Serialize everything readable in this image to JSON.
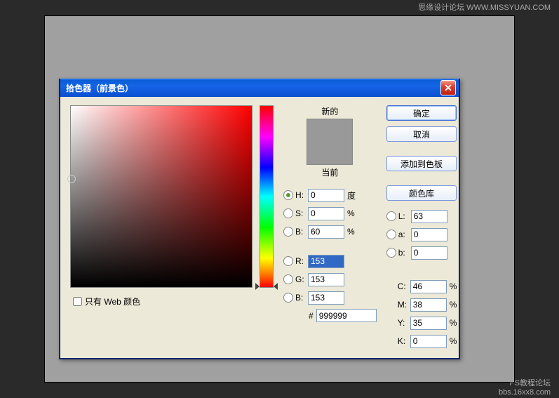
{
  "watermark": {
    "top": "思缘设计论坛  WWW.MISSYUAN.COM",
    "bottom_line1": "PS教程论坛",
    "bottom_line2": "bbs.16xx8.com"
  },
  "dialog": {
    "title": "拾色器（前景色）",
    "swatch": {
      "new_label": "新的",
      "current_label": "当前"
    },
    "buttons": {
      "ok": "确定",
      "cancel": "取消",
      "add": "添加到色板",
      "lib": "颜色库"
    },
    "web_only": "只有 Web 颜色",
    "hsb": {
      "h_label": "H:",
      "h_value": "0",
      "h_unit": "度",
      "s_label": "S:",
      "s_value": "0",
      "s_unit": "%",
      "b_label": "B:",
      "b_value": "60",
      "b_unit": "%"
    },
    "lab": {
      "l_label": "L:",
      "l_value": "63",
      "a_label": "a:",
      "a_value": "0",
      "b_label": "b:",
      "b_value": "0"
    },
    "rgb": {
      "r_label": "R:",
      "r_value": "153",
      "g_label": "G:",
      "g_value": "153",
      "b_label": "B:",
      "b_value": "153"
    },
    "cmyk": {
      "c_label": "C:",
      "c_value": "46",
      "m_label": "M:",
      "m_value": "38",
      "y_label": "Y:",
      "y_value": "35",
      "k_label": "K:",
      "k_value": "0"
    },
    "hex": {
      "hash": "#",
      "value": "999999"
    },
    "selected_color": "#999999"
  }
}
